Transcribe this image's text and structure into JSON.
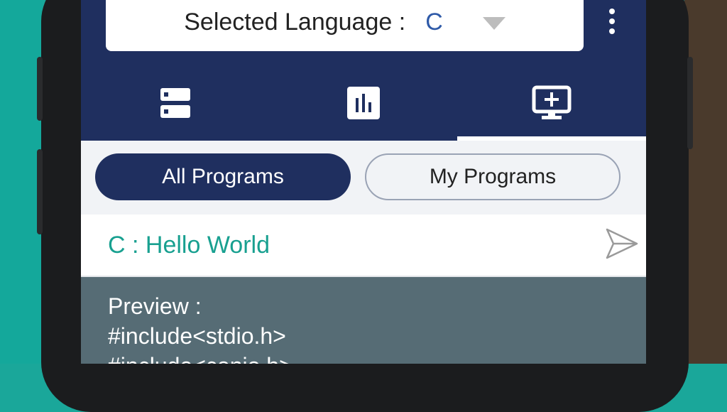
{
  "language_selector": {
    "label": "Selected Language :",
    "value": "C"
  },
  "tabs": [
    {
      "icon": "list-icon"
    },
    {
      "icon": "bar-chart-icon"
    },
    {
      "icon": "add-screen-icon"
    }
  ],
  "filters": {
    "all": "All Programs",
    "mine": "My Programs"
  },
  "program": {
    "title": "C : Hello World"
  },
  "preview": {
    "label": "Preview :",
    "lines": [
      "#include<stdio.h>",
      "#include<conio.h>"
    ]
  },
  "colors": {
    "header": "#1f2f5f",
    "accent_teal": "#18a090",
    "preview_bg": "#566c75"
  }
}
